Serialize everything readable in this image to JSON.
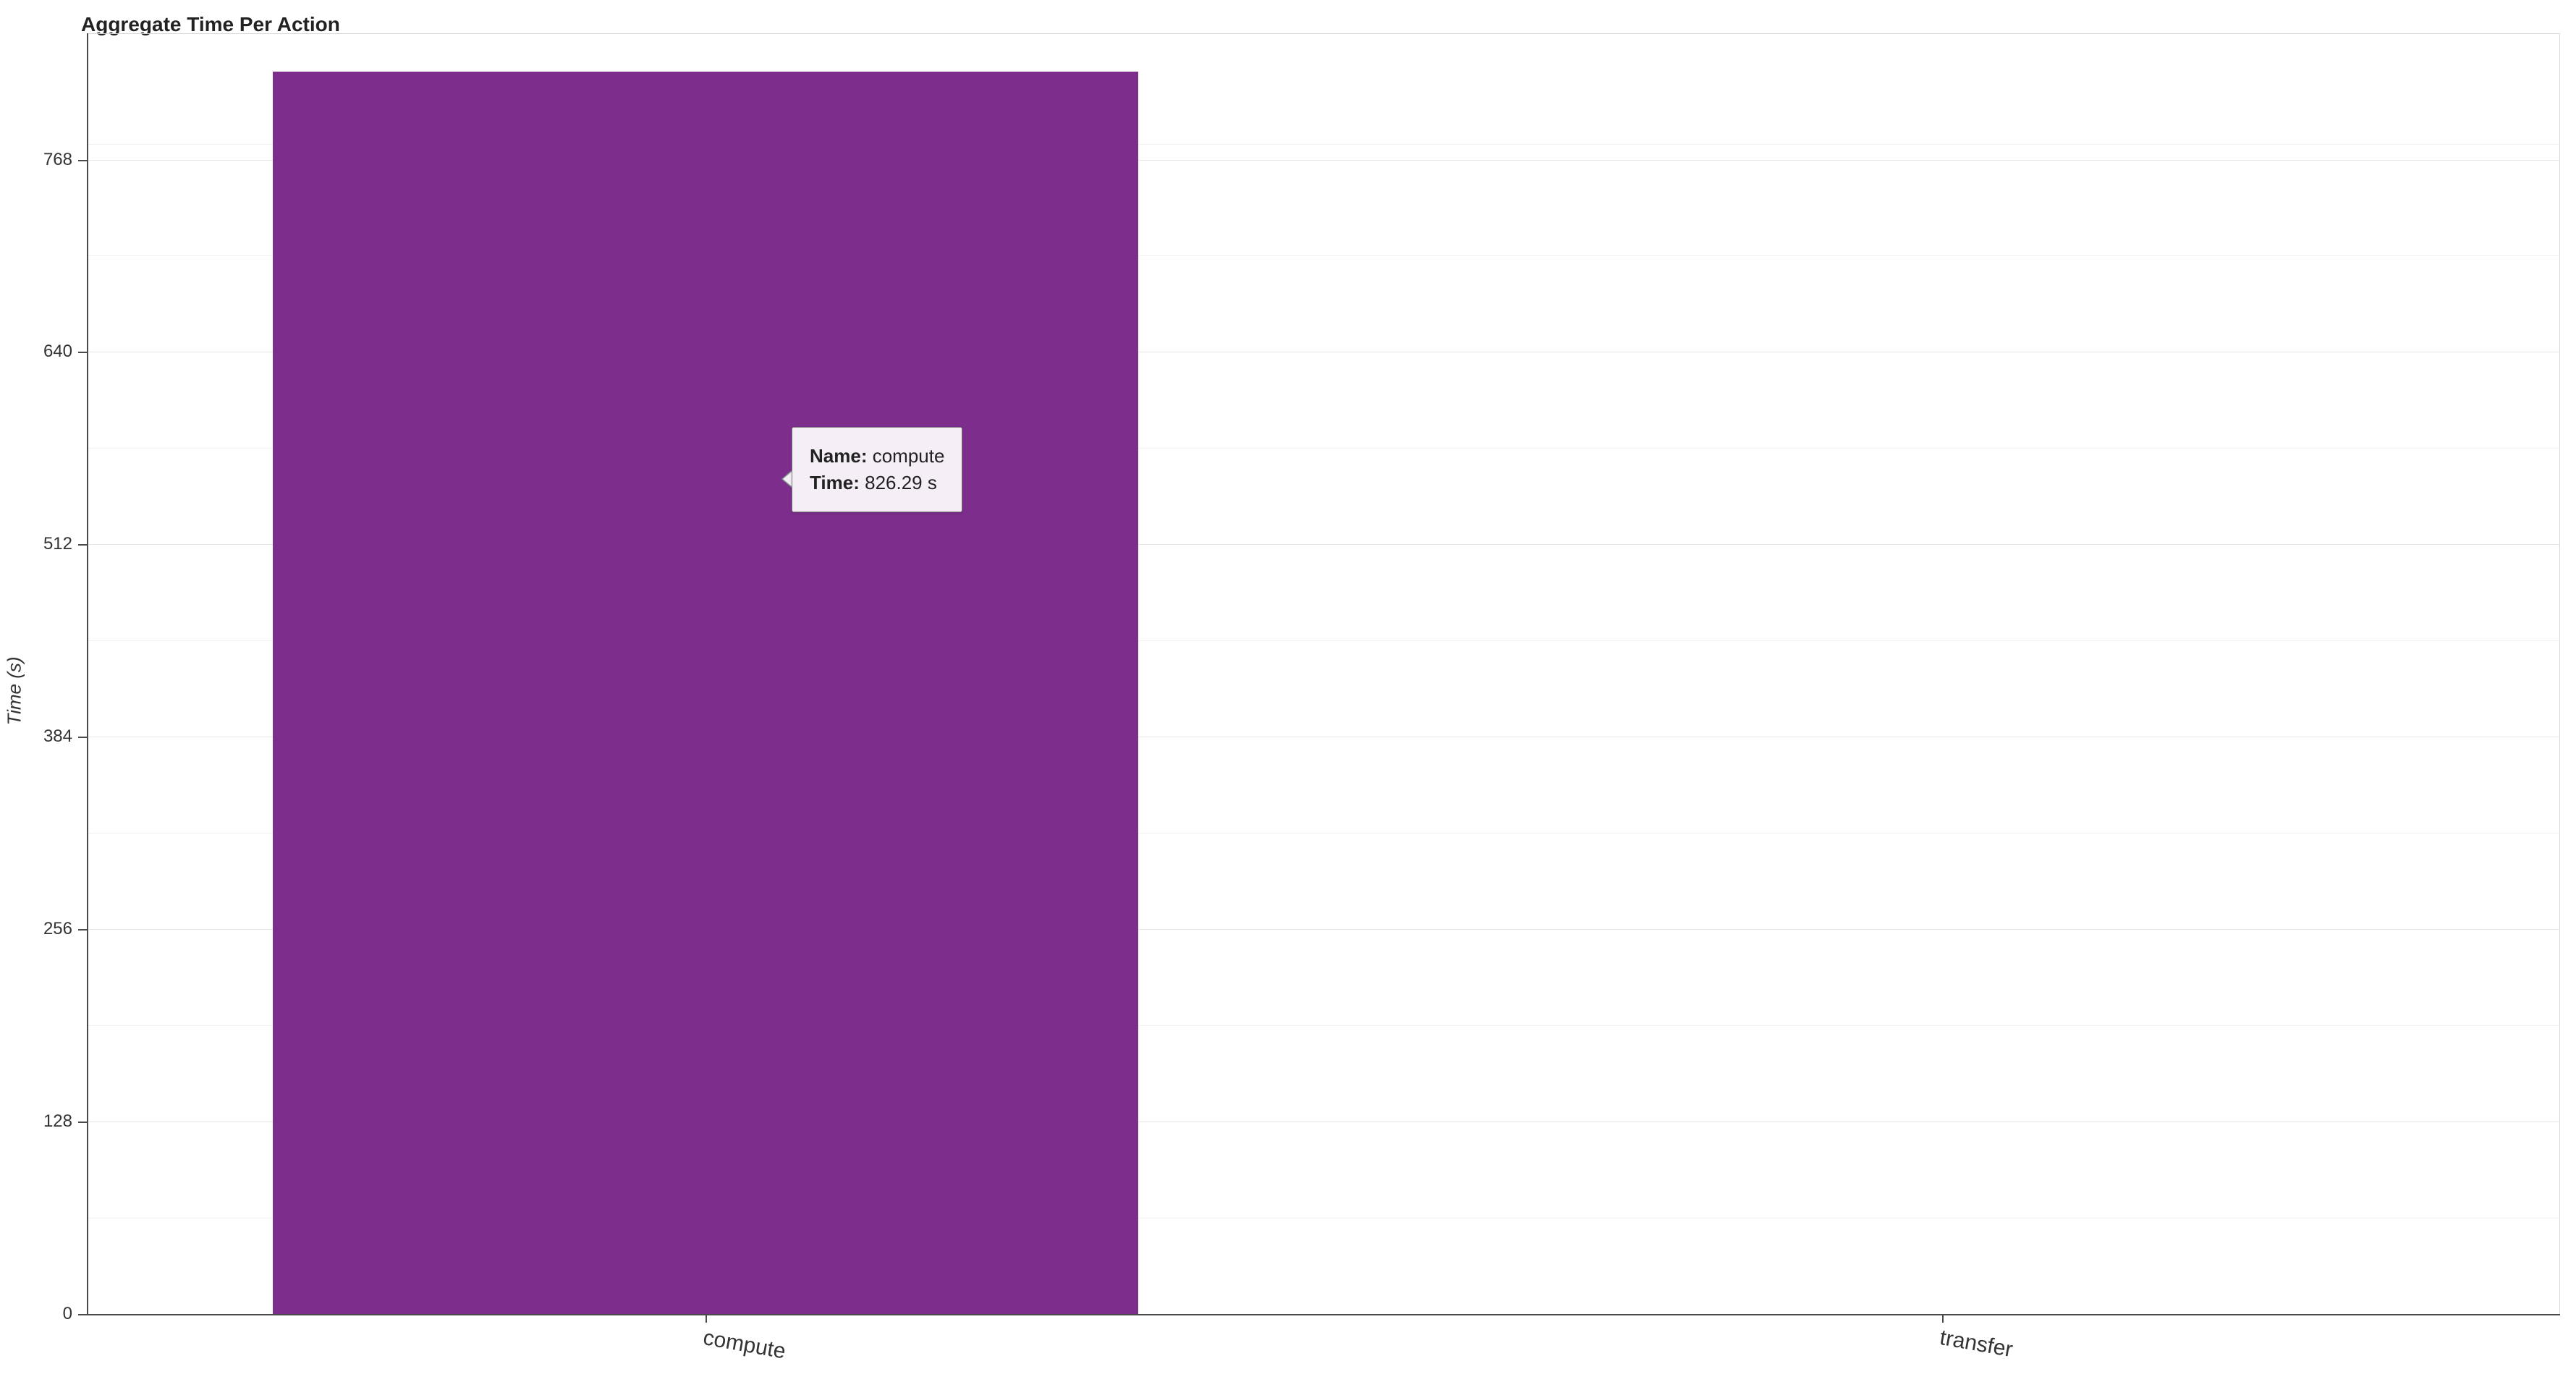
{
  "chart_data": {
    "type": "bar",
    "title": "Aggregate Time Per Action",
    "ylabel": "Time (s)",
    "xlabel": "",
    "categories": [
      "compute",
      "transfer"
    ],
    "values": [
      826.29,
      0
    ],
    "ylim": [
      0,
      852
    ],
    "yticks": [
      0,
      128,
      256,
      384,
      512,
      640,
      768
    ],
    "bar_color": "#7d2d8c"
  },
  "tooltip": {
    "name_label": "Name:",
    "name_value": "compute",
    "time_label": "Time:",
    "time_value": "826.29 s"
  },
  "ytick_labels": {
    "t0": "0",
    "t128": "128",
    "t256": "256",
    "t384": "384",
    "t512": "512",
    "t640": "640",
    "t768": "768"
  },
  "xtick_labels": {
    "compute": "compute",
    "transfer": "transfer"
  }
}
